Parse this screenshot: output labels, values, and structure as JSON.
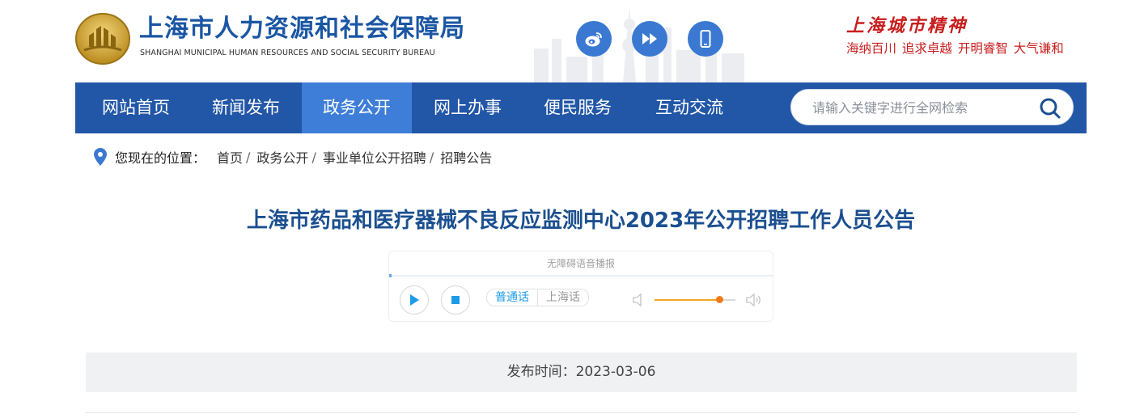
{
  "header": {
    "site_name": "上海市人力资源和社会保障局",
    "site_name_en": "SHANGHAI MUNICIPAL HUMAN RESOURCES AND SOCIAL SECURITY BUREAU",
    "social_icons": [
      "weibo-icon",
      "play-forward-icon",
      "mobile-phone-icon"
    ],
    "spirit_title": "上海城市精神",
    "spirit_slogan": "海纳百川  追求卓越  开明睿智  大气谦和"
  },
  "nav": {
    "items": [
      {
        "label": "网站首页",
        "active": false
      },
      {
        "label": "新闻发布",
        "active": false
      },
      {
        "label": "政务公开",
        "active": true
      },
      {
        "label": "网上办事",
        "active": false
      },
      {
        "label": "便民服务",
        "active": false
      },
      {
        "label": "互动交流",
        "active": false
      }
    ],
    "search_placeholder": "请输入关键字进行全网检索"
  },
  "breadcrumb": {
    "label": "您现在的位置：",
    "items": [
      "首页",
      "政务公开",
      "事业单位公开招聘",
      "招聘公告"
    ],
    "separator": "/"
  },
  "article": {
    "title": "上海市药品和医疗器械不良反应监测中心2023年公开招聘工作人员公告",
    "publish_time": "发布时间：2023-03-06"
  },
  "player": {
    "title": "无障碍语音播报",
    "languages": [
      "普通话",
      "上海话"
    ],
    "selected_language": "普通话",
    "volume": 0.8
  },
  "colors": {
    "nav_bg": "#2257a7",
    "nav_active": "#3f7ed8",
    "title": "#1b4f8f",
    "slogan": "#c81e1e",
    "social": "#3a78d2"
  }
}
